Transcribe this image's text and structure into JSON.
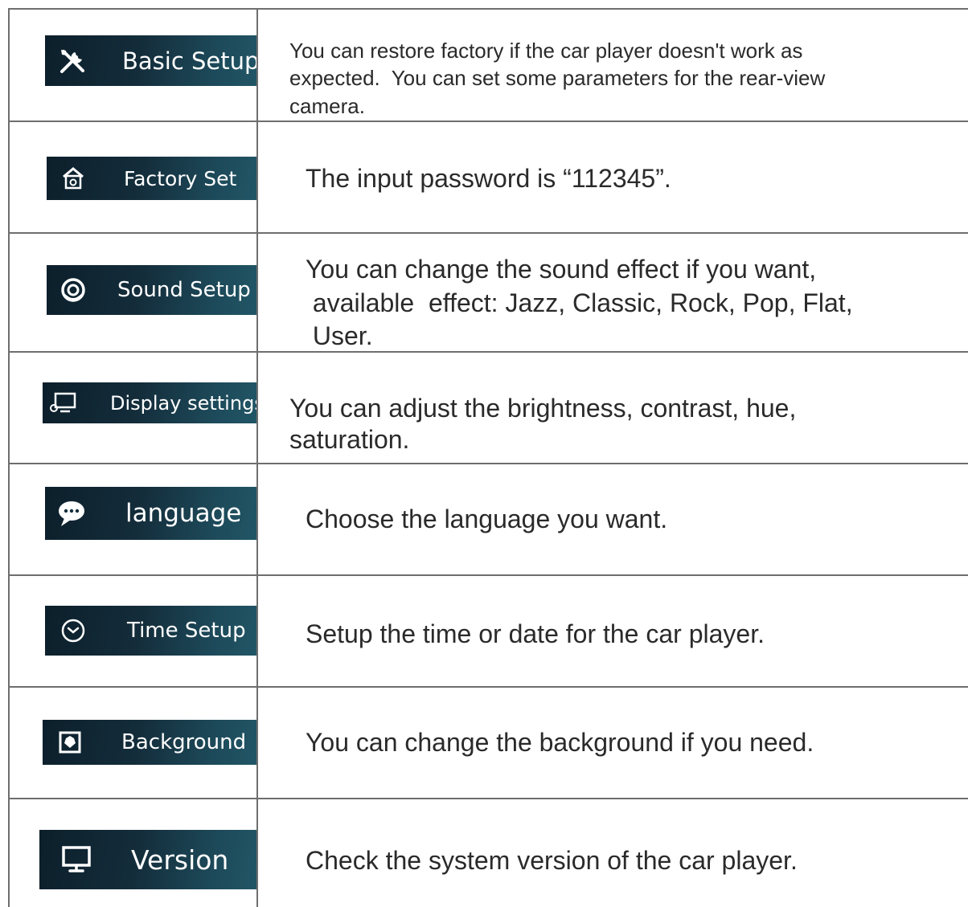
{
  "rows": [
    {
      "label": "Basic Setup",
      "icon": "tools-icon",
      "description": [
        "You can restore factory if the car player doesn't work as",
        "expected.  You can set some parameters for the rear-view",
        "camera."
      ]
    },
    {
      "label": "Factory Set",
      "icon": "factory-house-icon",
      "description": [
        "The input password is “112345”."
      ]
    },
    {
      "label": "Sound Setup",
      "icon": "speaker-icon",
      "description": [
        "You can change the sound effect if you want,",
        " available  effect: Jazz, Classic, Rock, Pop, Flat,",
        " User."
      ]
    },
    {
      "label": "Display settings",
      "icon": "display-settings-icon",
      "description": [
        "You can adjust the brightness, contrast, hue,",
        "saturation."
      ]
    },
    {
      "label": "language",
      "icon": "speech-bubble-icon",
      "description": [
        "Choose the language you want."
      ]
    },
    {
      "label": "Time Setup",
      "icon": "clock-icon",
      "description": [
        "Setup the time or date for the car player."
      ]
    },
    {
      "label": "Background",
      "icon": "picture-icon",
      "description": [
        "You can change the background if you need."
      ]
    },
    {
      "label": "Version",
      "icon": "monitor-icon",
      "description": [
        "Check the system version of the car player."
      ]
    }
  ],
  "colors": {
    "button_dark": "#0c1f2b",
    "button_light": "#215666",
    "grid_line": "#6e6e6e",
    "text": "#2a2a2a"
  }
}
